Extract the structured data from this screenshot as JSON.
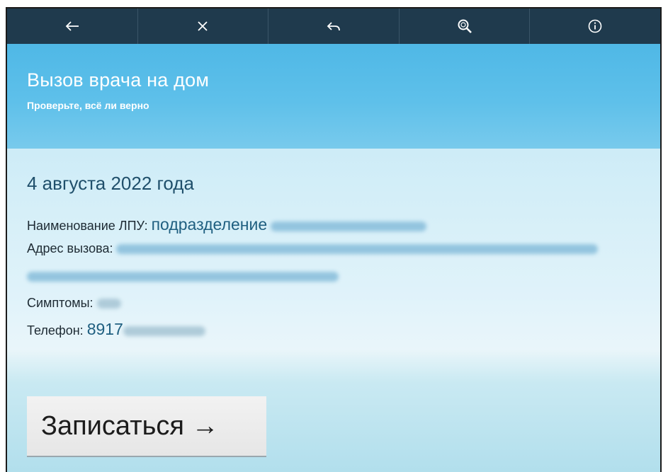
{
  "toolbar": {
    "buttons": [
      {
        "icon": "arrow-left-icon"
      },
      {
        "icon": "close-icon"
      },
      {
        "icon": "undo-icon"
      },
      {
        "icon": "search-icon"
      },
      {
        "icon": "info-icon"
      }
    ]
  },
  "header": {
    "title": "Вызов врача на дом",
    "subtitle": "Проверьте, всё ли верно"
  },
  "details": {
    "date": "4 августа 2022 года",
    "lpu_label": "Наименование ЛПУ:",
    "lpu_value": "подразделение",
    "address_label": "Адрес вызова:",
    "symptoms_label": "Симптомы:",
    "phone_label": "Телефон:",
    "phone_value": "8917"
  },
  "actions": {
    "submit_label": "Записаться →"
  },
  "colors": {
    "toolbar_bg": "#1f3a4d",
    "header_bg": "#5ec0ea",
    "value_text": "#1f5f80",
    "button_bg": "#eeeeee"
  }
}
